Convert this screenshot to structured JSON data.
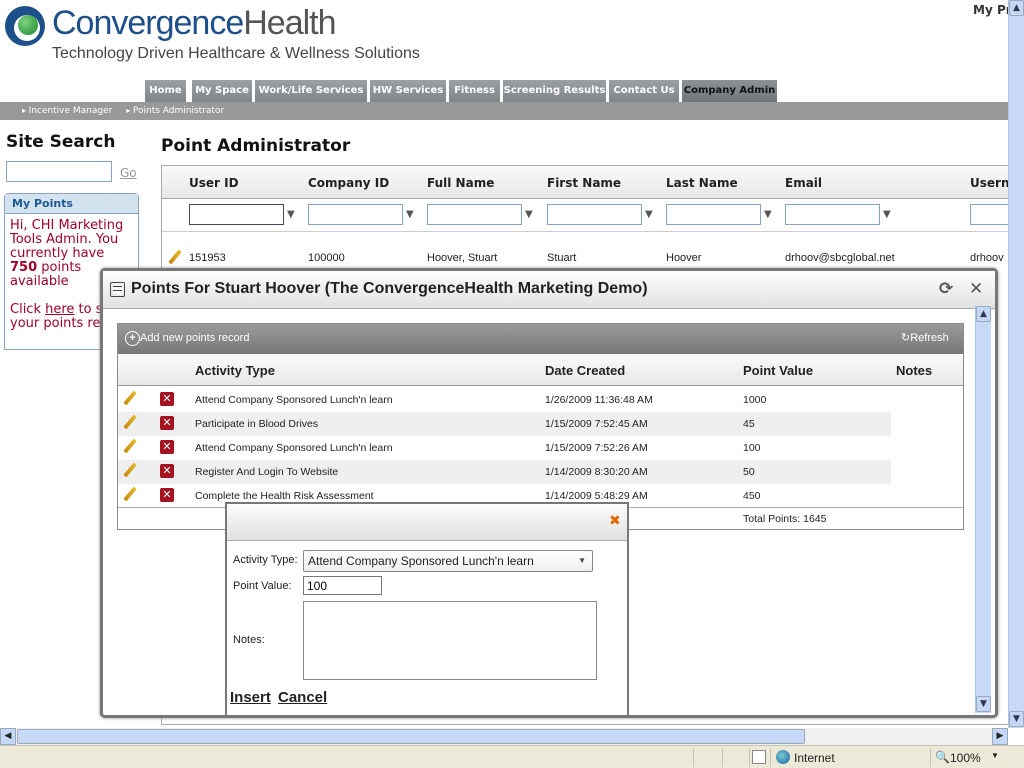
{
  "brand": {
    "name_part1": "Convergence",
    "name_part2": "Health",
    "tagline": "Technology Driven Healthcare & Wellness Solutions"
  },
  "top_right_link": "My Pr",
  "nav": {
    "tabs": [
      "Home",
      "My Space",
      "Work/Life Services",
      "HW Services",
      "Fitness",
      "Screening Results",
      "Contact Us",
      "Company Admin"
    ],
    "active": "Company Admin"
  },
  "breadcrumb": [
    "Incentive Manager",
    "Points Administrator"
  ],
  "sidebar": {
    "search_title": "Site Search",
    "go_label": "Go",
    "my_points": {
      "title": "My Points",
      "line1": "Hi, CHI Marketing Tools Admin. You currently have ",
      "points": "750",
      "line2": " points available",
      "click": "Click ",
      "here": "here",
      "rest": " to see your points report"
    }
  },
  "main": {
    "title": "Point Administrator",
    "columns": [
      "User ID",
      "Company ID",
      "Full Name",
      "First Name",
      "Last Name",
      "Email",
      "Usern"
    ],
    "rows": [
      {
        "user_id": "151953",
        "company_id": "100000",
        "full_name": "Hoover, Stuart",
        "first_name": "Stuart",
        "last_name": "Hoover",
        "email": "drhoov@sbcglobal.net",
        "username": "drhoov"
      }
    ]
  },
  "modal": {
    "title": "Points For Stuart Hoover (The ConvergenceHealth Marketing Demo)",
    "add_label": "Add new points record",
    "refresh_label": "Refresh",
    "columns": [
      "Activity Type",
      "Date Created",
      "Point Value",
      "Notes"
    ],
    "rows": [
      {
        "activity": "Attend Company Sponsored Lunch'n learn",
        "date": "1/26/2009 11:36:48 AM",
        "points": "1000"
      },
      {
        "activity": "Participate in Blood Drives",
        "date": "1/15/2009 7:52:45 AM",
        "points": "45"
      },
      {
        "activity": "Attend Company Sponsored Lunch'n learn",
        "date": "1/15/2009 7:52:26 AM",
        "points": "100"
      },
      {
        "activity": "Register And Login To Website",
        "date": "1/14/2009 8:30:20 AM",
        "points": "50"
      },
      {
        "activity": "Complete the Health Risk Assessment",
        "date": "1/14/2009 5:48:29 AM",
        "points": "450"
      }
    ],
    "total": "Total Points: 1645"
  },
  "insert_form": {
    "activity_label": "Activity Type:",
    "activity_value": "Attend Company Sponsored Lunch'n learn",
    "points_label": "Point Value:",
    "points_value": "100",
    "notes_label": "Notes:",
    "insert": "Insert",
    "cancel": "Cancel"
  },
  "statusbar": {
    "zone": "Internet",
    "zoom": "100%"
  }
}
